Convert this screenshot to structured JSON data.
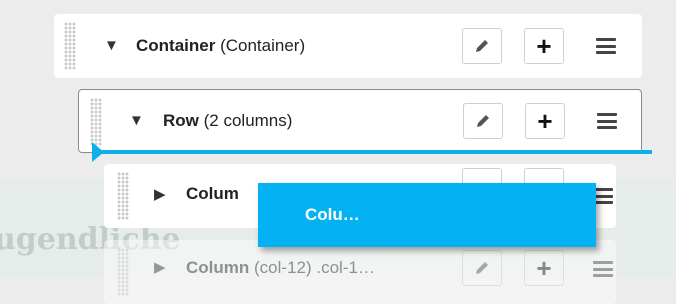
{
  "background": {
    "watermark_text": "ugendliche"
  },
  "tree": {
    "container": {
      "name": "Container",
      "detail": "(Container)"
    },
    "row": {
      "name": "Row",
      "detail": "(2 columns)"
    },
    "column_1": {
      "name": "Colum"
    },
    "column_2": {
      "name": "Column",
      "detail": "(col-12) .col-1…"
    }
  },
  "drag_ghost": {
    "label": "Colu…"
  },
  "colors": {
    "drop_indicator": "#0fb0ea",
    "drag_ghost": "#04b2f3"
  },
  "icons": {
    "expanded": "caret-down-icon",
    "collapsed": "caret-right-icon",
    "edit": "pencil-icon",
    "add": "plus-icon",
    "menu": "hamburger-icon"
  }
}
